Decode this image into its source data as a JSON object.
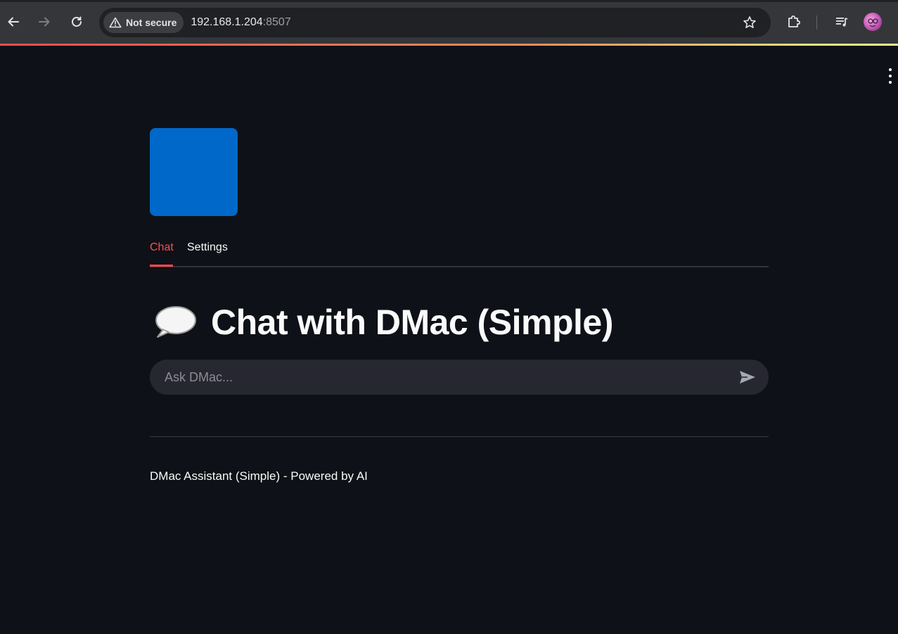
{
  "browser": {
    "security_label": "Not secure",
    "url_host": "192.168.1.204",
    "url_port": ":8507",
    "icons": {
      "back": "back-arrow-icon",
      "forward": "forward-arrow-icon",
      "reload": "reload-icon",
      "warning": "warning-triangle-icon",
      "bookmark": "star-icon",
      "extensions": "puzzle-icon",
      "media": "media-queue-icon",
      "profile": "profile-avatar"
    }
  },
  "app": {
    "accent_color": "#ff4b4b",
    "logo_color": "#0068c9",
    "tabs": [
      {
        "label": "Chat",
        "active": true
      },
      {
        "label": "Settings",
        "active": false
      }
    ],
    "title_icon": "speech-balloon-icon",
    "title": "Chat with DMac (Simple)",
    "chat_input": {
      "placeholder": "Ask DMac...",
      "value": ""
    },
    "send_icon": "send-icon",
    "footer": "DMac Assistant (Simple) - Powered by AI"
  }
}
